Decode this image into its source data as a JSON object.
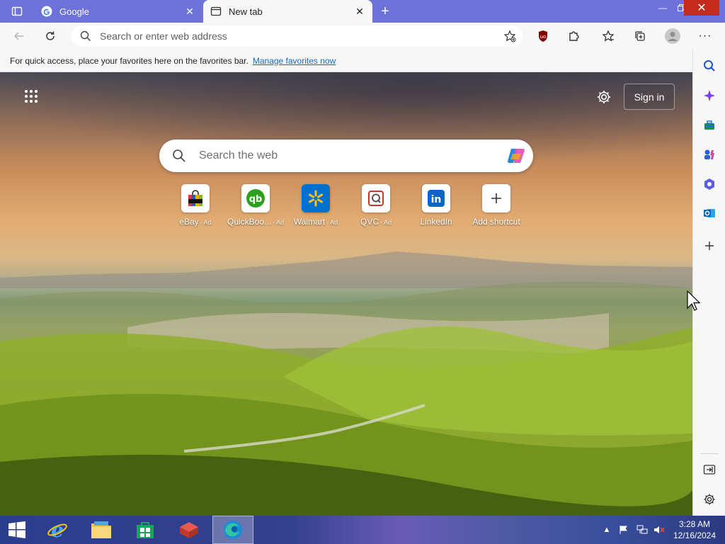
{
  "tabs": [
    {
      "title": "Google",
      "active": false,
      "icon": "google-g-icon"
    },
    {
      "title": "New tab",
      "active": true,
      "icon": "newtab-page-icon"
    }
  ],
  "address_bar": {
    "placeholder": "Search or enter web address"
  },
  "favorites_bar": {
    "message": "For quick access, place your favorites here on the favorites bar.",
    "link": "Manage favorites now"
  },
  "new_tab_page": {
    "sign_in": "Sign in",
    "search_placeholder": "Search the web",
    "shortcuts": [
      {
        "label": "eBay",
        "ad": "· Ad",
        "icon": "ebay-bag-icon"
      },
      {
        "label": "QuickBoo...",
        "ad": "· Ad",
        "icon": "quickbooks-icon"
      },
      {
        "label": "Walmart",
        "ad": "· Ad",
        "icon": "walmart-spark-icon"
      },
      {
        "label": "QVC",
        "ad": "· Ad",
        "icon": "qvc-icon"
      },
      {
        "label": "LinkedIn",
        "ad": "",
        "icon": "linkedin-icon"
      },
      {
        "label": "Add shortcut",
        "ad": "",
        "icon": "plus-icon"
      }
    ]
  },
  "taskbar": {
    "time": "3:28 AM",
    "date": "12/16/2024"
  },
  "colors": {
    "tabstrip": "#6d72d8",
    "toolbar": "#f7f7f7",
    "link": "#0f6cbd",
    "close_button": "#c42b1c"
  }
}
